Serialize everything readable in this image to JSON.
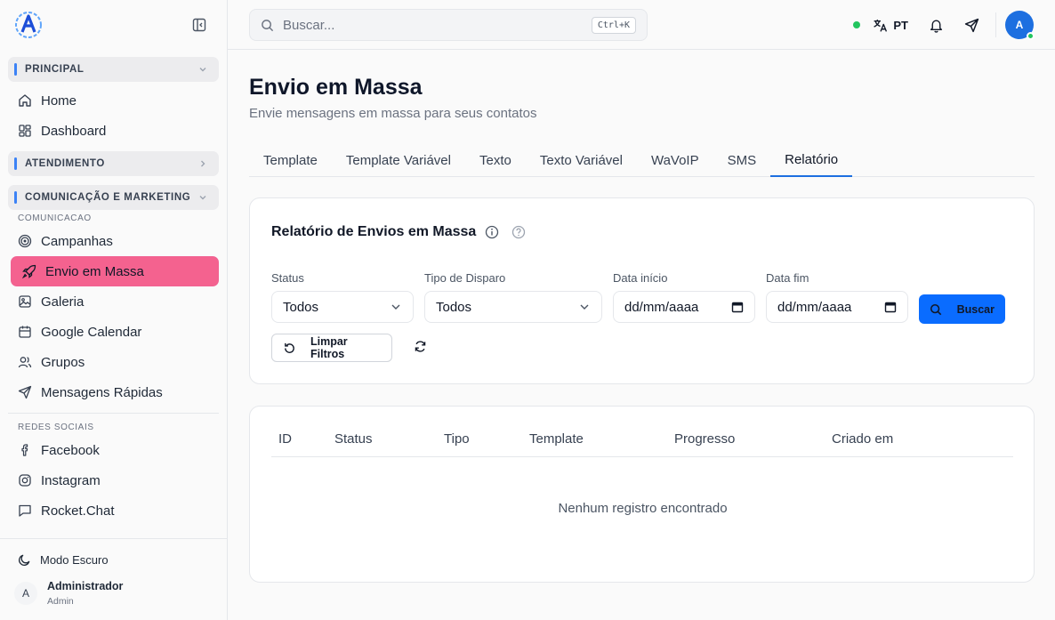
{
  "sidebar": {
    "sections": [
      {
        "label": "PRINCIPAL"
      },
      {
        "label": "ATENDIMENTO"
      },
      {
        "label": "COMUNICAÇÃO E MARKETING"
      }
    ],
    "principal_items": [
      {
        "label": "Home",
        "icon": "home-icon"
      },
      {
        "label": "Dashboard",
        "icon": "dashboard-icon"
      }
    ],
    "comunicacao_label": "COMUNICACAO",
    "comunicacao_items": [
      {
        "label": "Campanhas",
        "icon": "target-icon"
      },
      {
        "label": "Envio em Massa",
        "icon": "rocket-icon"
      },
      {
        "label": "Galeria",
        "icon": "image-icon"
      },
      {
        "label": "Google Calendar",
        "icon": "calendar-icon"
      },
      {
        "label": "Grupos",
        "icon": "users-icon"
      },
      {
        "label": "Mensagens Rápidas",
        "icon": "send-icon"
      }
    ],
    "redes_label": "REDES SOCIAIS",
    "redes_items": [
      {
        "label": "Facebook",
        "icon": "facebook-icon"
      },
      {
        "label": "Instagram",
        "icon": "instagram-icon"
      },
      {
        "label": "Rocket.Chat",
        "icon": "chat-icon"
      }
    ],
    "footer": {
      "dark_mode": "Modo Escuro",
      "user_initial": "A",
      "user_name": "Administrador",
      "user_role": "Admin"
    }
  },
  "topbar": {
    "search_placeholder": "Buscar...",
    "shortcut": "Ctrl+K",
    "language": "PT",
    "avatar_initial": "A"
  },
  "page": {
    "title": "Envio em Massa",
    "subtitle": "Envie mensagens em massa para seus contatos",
    "tabs": [
      "Template",
      "Template Variável",
      "Texto",
      "Texto Variável",
      "WaVoIP",
      "SMS",
      "Relatório"
    ],
    "active_tab": "Relatório"
  },
  "filters": {
    "title": "Relatório de Envios em Massa",
    "status_label": "Status",
    "status_value": "Todos",
    "tipo_label": "Tipo de Disparo",
    "tipo_value": "Todos",
    "data_inicio_label": "Data início",
    "data_inicio_value": "dd/mm/aaaa",
    "data_fim_label": "Data fim",
    "data_fim_value": "dd/mm/aaaa",
    "buscar": "Buscar",
    "limpar": "Limpar Filtros"
  },
  "table": {
    "columns": [
      "ID",
      "Status",
      "Tipo",
      "Template",
      "Progresso",
      "Criado em"
    ],
    "empty": "Nenhum registro encontrado"
  },
  "colors": {
    "accent": "#0a6cff",
    "active_nav": "#f4628f",
    "online": "#22c55e"
  }
}
